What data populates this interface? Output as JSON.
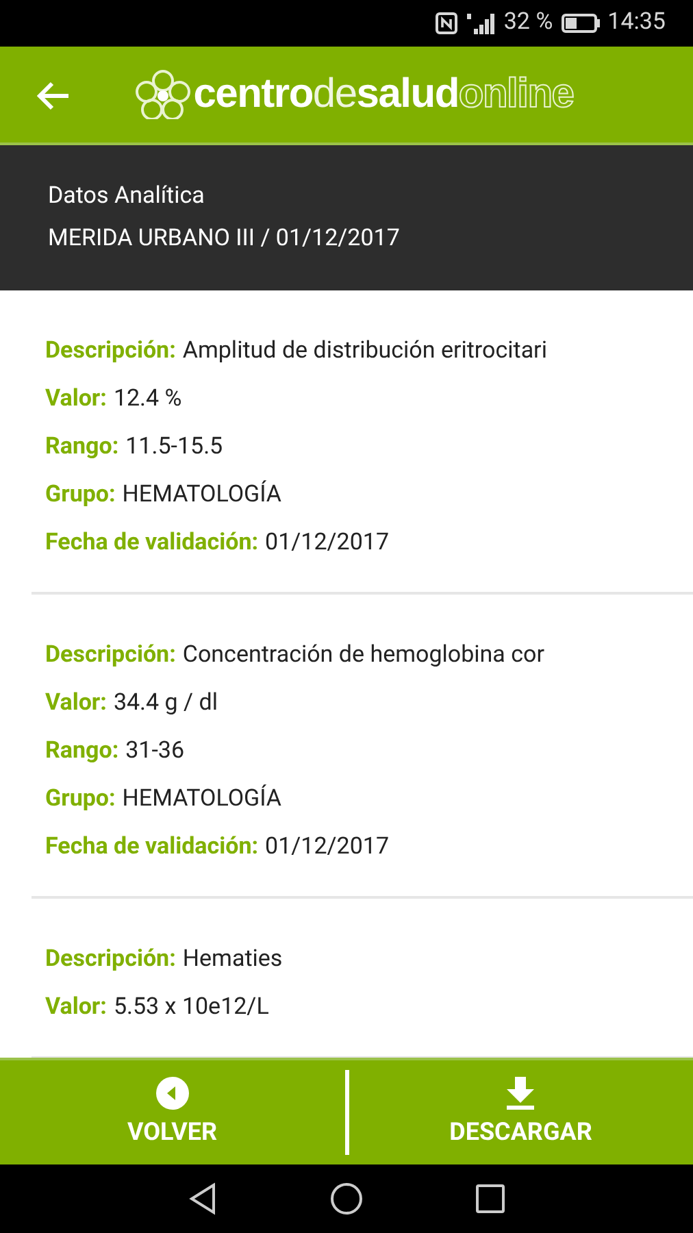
{
  "status_bar": {
    "battery": "32 %",
    "time": "14:35"
  },
  "header": {
    "logo": [
      {
        "text": "centro",
        "kind": "bold"
      },
      {
        "text": "de",
        "kind": "light"
      },
      {
        "text": "salud",
        "kind": "bold"
      },
      {
        "text": "online",
        "kind": "outline"
      }
    ]
  },
  "subheader": {
    "title": "Datos Analítica",
    "subtitle": "MERIDA URBANO III / 01/12/2017"
  },
  "results": [
    {
      "fields": [
        {
          "label": "Descripción:",
          "value": "Amplitud de distribución eritrocitari"
        },
        {
          "label": "Valor:",
          "value": "12.4 %"
        },
        {
          "label": "Rango:",
          "value": "11.5-15.5"
        },
        {
          "label": "Grupo:",
          "value": "HEMATOLOGÍA"
        },
        {
          "label": "Fecha de validación:",
          "value": "01/12/2017"
        }
      ]
    },
    {
      "fields": [
        {
          "label": "Descripción:",
          "value": "Concentración de hemoglobina cor"
        },
        {
          "label": "Valor:",
          "value": "34.4 g / dl"
        },
        {
          "label": "Rango:",
          "value": "31-36"
        },
        {
          "label": "Grupo:",
          "value": "HEMATOLOGÍA"
        },
        {
          "label": "Fecha de validación:",
          "value": "01/12/2017"
        }
      ]
    },
    {
      "fields": [
        {
          "label": "Descripción:",
          "value": "Hematies"
        },
        {
          "label": "Valor:",
          "value": "5.53 x 10e12/L"
        }
      ]
    }
  ],
  "bottom_bar": [
    {
      "kind": "back",
      "label": "VOLVER"
    },
    {
      "kind": "download",
      "label": "DESCARGAR"
    }
  ]
}
